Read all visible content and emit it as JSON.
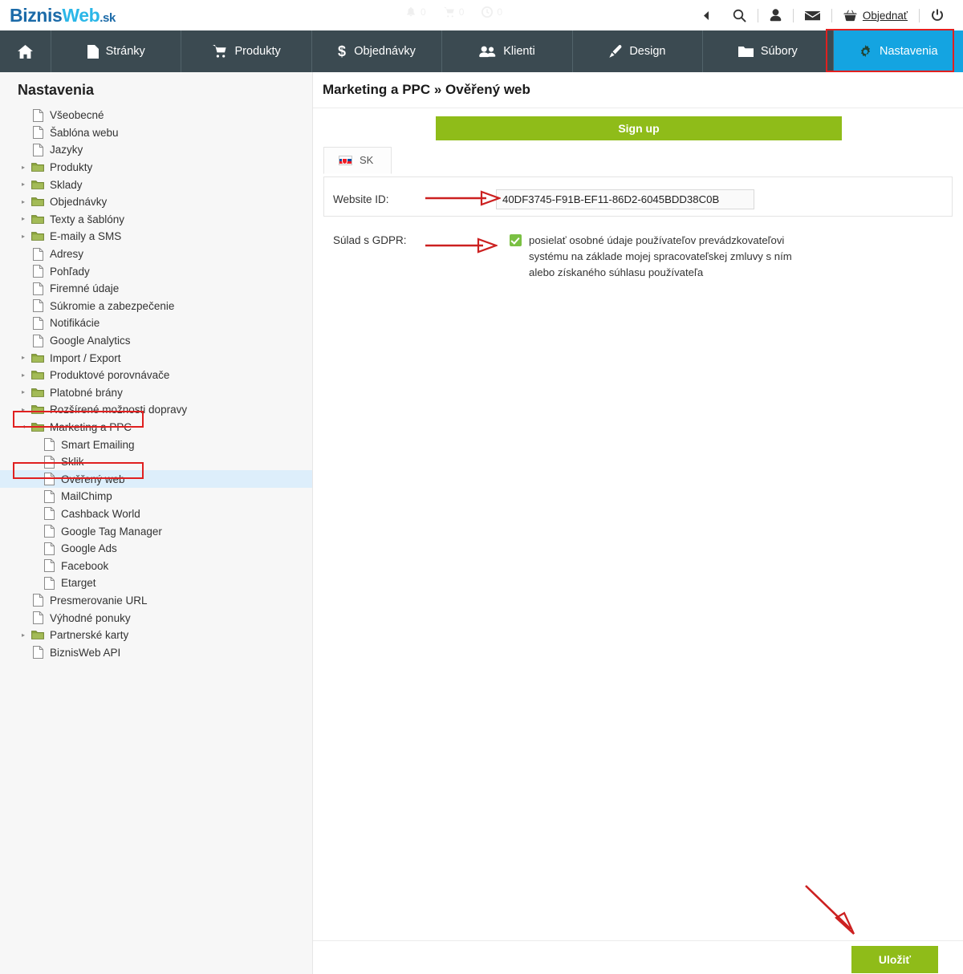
{
  "brand": {
    "part1": "Biznis",
    "part2": "Web",
    "part3": ".sk"
  },
  "header": {
    "faded_items": [
      {
        "icon": "bell-icon",
        "count": "0"
      },
      {
        "icon": "cart-icon",
        "count": "0"
      },
      {
        "icon": "clock-icon",
        "count": "0"
      }
    ],
    "collapse_icon": "caret-left-icon",
    "search_icon": "search-icon",
    "user_icon": "user-icon",
    "mail_icon": "mail-icon",
    "order_icon": "basket-icon",
    "order_label": "Objednať",
    "power_icon": "power-icon"
  },
  "mainnav": {
    "items": [
      {
        "label": "",
        "icon": "home-icon",
        "active": false
      },
      {
        "label": "Stránky",
        "icon": "page-icon",
        "active": false
      },
      {
        "label": "Produkty",
        "icon": "cart-icon",
        "active": false
      },
      {
        "label": "Objednávky",
        "icon": "dollar-icon",
        "active": false
      },
      {
        "label": "Klienti",
        "icon": "users-icon",
        "active": false
      },
      {
        "label": "Design",
        "icon": "brush-icon",
        "active": false
      },
      {
        "label": "Súbory",
        "icon": "folder-icon",
        "active": false
      },
      {
        "label": "Nastavenia",
        "icon": "gear-icon",
        "active": true
      }
    ]
  },
  "sidebar": {
    "title": "Nastavenia",
    "items": [
      {
        "label": "Všeobecné",
        "icon": "file-icon",
        "level": 0,
        "expandable": false,
        "selected": false
      },
      {
        "label": "Šablóna webu",
        "icon": "file-icon",
        "level": 0,
        "expandable": false,
        "selected": false
      },
      {
        "label": "Jazyky",
        "icon": "file-icon",
        "level": 0,
        "expandable": false,
        "selected": false
      },
      {
        "label": "Produkty",
        "icon": "folder-icon",
        "level": 0,
        "expandable": true,
        "expanded": false,
        "selected": false
      },
      {
        "label": "Sklady",
        "icon": "folder-icon",
        "level": 0,
        "expandable": true,
        "expanded": false,
        "selected": false
      },
      {
        "label": "Objednávky",
        "icon": "folder-icon",
        "level": 0,
        "expandable": true,
        "expanded": false,
        "selected": false
      },
      {
        "label": "Texty a šablóny",
        "icon": "folder-icon",
        "level": 0,
        "expandable": true,
        "expanded": false,
        "selected": false
      },
      {
        "label": "E-maily a SMS",
        "icon": "folder-icon",
        "level": 0,
        "expandable": true,
        "expanded": false,
        "selected": false
      },
      {
        "label": "Adresy",
        "icon": "file-icon",
        "level": 0,
        "expandable": false,
        "selected": false
      },
      {
        "label": "Pohľady",
        "icon": "file-icon",
        "level": 0,
        "expandable": false,
        "selected": false
      },
      {
        "label": "Firemné údaje",
        "icon": "file-icon",
        "level": 0,
        "expandable": false,
        "selected": false
      },
      {
        "label": "Súkromie a zabezpečenie",
        "icon": "file-icon",
        "level": 0,
        "expandable": false,
        "selected": false
      },
      {
        "label": "Notifikácie",
        "icon": "file-icon",
        "level": 0,
        "expandable": false,
        "selected": false
      },
      {
        "label": "Google Analytics",
        "icon": "file-icon",
        "level": 0,
        "expandable": false,
        "selected": false
      },
      {
        "label": "Import / Export",
        "icon": "folder-icon",
        "level": 0,
        "expandable": true,
        "expanded": false,
        "selected": false
      },
      {
        "label": "Produktové porovnávače",
        "icon": "folder-icon",
        "level": 0,
        "expandable": true,
        "expanded": false,
        "selected": false
      },
      {
        "label": "Platobné brány",
        "icon": "folder-icon",
        "level": 0,
        "expandable": true,
        "expanded": false,
        "selected": false
      },
      {
        "label": "Rozšírené možnosti dopravy",
        "icon": "folder-icon",
        "level": 0,
        "expandable": true,
        "expanded": false,
        "selected": false
      },
      {
        "label": "Marketing a PPC",
        "icon": "folder-icon",
        "level": 0,
        "expandable": true,
        "expanded": true,
        "selected": false,
        "highlighted": true
      },
      {
        "label": "Smart Emailing",
        "icon": "file-icon",
        "level": 1,
        "expandable": false,
        "selected": false
      },
      {
        "label": "Sklik",
        "icon": "file-icon",
        "level": 1,
        "expandable": false,
        "selected": false
      },
      {
        "label": "Ověřený web",
        "icon": "file-icon",
        "level": 1,
        "expandable": false,
        "selected": true,
        "highlighted": true
      },
      {
        "label": "MailChimp",
        "icon": "file-icon",
        "level": 1,
        "expandable": false,
        "selected": false
      },
      {
        "label": "Cashback World",
        "icon": "file-icon",
        "level": 1,
        "expandable": false,
        "selected": false
      },
      {
        "label": "Google Tag Manager",
        "icon": "file-icon",
        "level": 1,
        "expandable": false,
        "selected": false
      },
      {
        "label": "Google Ads",
        "icon": "file-icon",
        "level": 1,
        "expandable": false,
        "selected": false
      },
      {
        "label": "Facebook",
        "icon": "file-icon",
        "level": 1,
        "expandable": false,
        "selected": false
      },
      {
        "label": "Etarget",
        "icon": "file-icon",
        "level": 1,
        "expandable": false,
        "selected": false
      },
      {
        "label": "Presmerovanie URL",
        "icon": "file-icon",
        "level": 0,
        "expandable": false,
        "selected": false
      },
      {
        "label": "Výhodné ponuky",
        "icon": "file-icon",
        "level": 0,
        "expandable": false,
        "selected": false
      },
      {
        "label": "Partnerské karty",
        "icon": "folder-icon",
        "level": 0,
        "expandable": true,
        "expanded": false,
        "selected": false
      },
      {
        "label": "BiznisWeb API",
        "icon": "file-icon",
        "level": 0,
        "expandable": false,
        "selected": false
      }
    ]
  },
  "main": {
    "page_title": "Marketing a PPC » Ověřený web",
    "signup_label": "Sign up",
    "lang_tab": {
      "label": "SK",
      "flag": "slovakia-flag-icon"
    },
    "website_id": {
      "label": "Website ID:",
      "value": "40DF3745-F91B-EF11-86D2-6045BDD38C0B",
      "placeholder": ""
    },
    "gdpr": {
      "label": "Súlad s GDPR:",
      "checked": true,
      "text": "posielať osobné údaje používateľov prevádzkovateľovi systému na základe mojej spracovateľskej zmluvy s ním alebo získaného súhlasu používateľa"
    },
    "save_label": "Uložiť"
  },
  "colors": {
    "accent_blue": "#14a4e1",
    "nav_dark": "#3b4a51",
    "green": "#8fbc19",
    "checkbox_green": "#7ac043",
    "annotation_red": "#cc2020",
    "sidebar_bg": "#f7f7f7",
    "selected_row": "#ddeefb"
  }
}
